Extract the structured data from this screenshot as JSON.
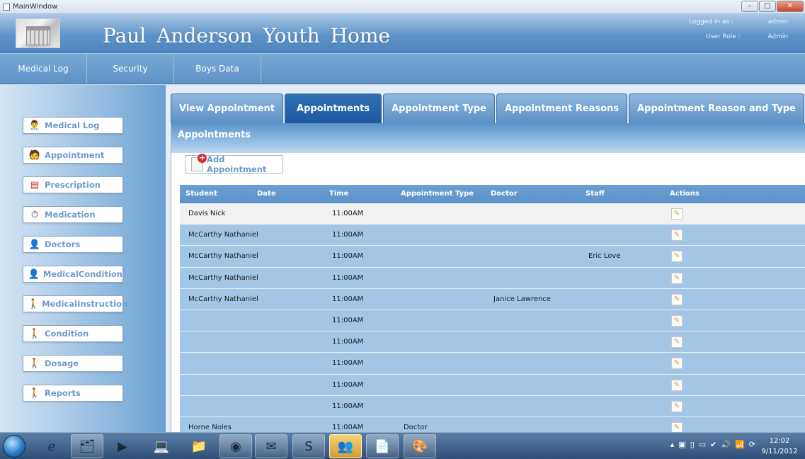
{
  "window": {
    "title": "MainWindow"
  },
  "header": {
    "app_title": "Paul  Anderson  Youth  Home",
    "logged_in_label": "Logged in as :",
    "logged_in_value": "admin",
    "role_label": "User Role :",
    "role_value": "Admin"
  },
  "topnav": {
    "items": [
      {
        "label": "Medical Log"
      },
      {
        "label": "Security"
      },
      {
        "label": "Boys Data"
      }
    ]
  },
  "sidebar": {
    "items": [
      {
        "label": "Medical Log",
        "icon": "medical-log-icon"
      },
      {
        "label": "Appointment",
        "icon": "appointment-icon"
      },
      {
        "label": "Prescription",
        "icon": "prescription-icon"
      },
      {
        "label": "Medication",
        "icon": "medication-icon"
      },
      {
        "label": "Doctors",
        "icon": "doctor-icon"
      },
      {
        "label": "MedicalCondition",
        "icon": "medical-condition-icon"
      },
      {
        "label": "MedicalInstruction",
        "icon": "medical-instruction-icon"
      },
      {
        "label": "Condition",
        "icon": "condition-icon"
      },
      {
        "label": "Dosage",
        "icon": "dosage-icon"
      },
      {
        "label": "Reports",
        "icon": "reports-icon"
      }
    ]
  },
  "tabs": [
    {
      "label": "View Appointment",
      "active": false
    },
    {
      "label": "Appointments",
      "active": true
    },
    {
      "label": "Appointment Type",
      "active": false
    },
    {
      "label": "Appointment Reasons",
      "active": false
    },
    {
      "label": "Appointment Reason and Type",
      "active": false
    }
  ],
  "panel": {
    "title": "Appointments",
    "add_button": "Add Appointment"
  },
  "table": {
    "columns": [
      "Student",
      "Date",
      "Time",
      "Appointment Type",
      "Doctor",
      "Staff",
      "Actions"
    ],
    "rows": [
      {
        "student": "Davis Nick",
        "date": "",
        "time": "11:00AM",
        "type": "",
        "doctor": "",
        "staff": ""
      },
      {
        "student": "McCarthy Nathaniel",
        "date": "",
        "time": "11:00AM",
        "type": "",
        "doctor": "",
        "staff": ""
      },
      {
        "student": "McCarthy Nathaniel",
        "date": "",
        "time": "11:00AM",
        "type": "",
        "doctor": "",
        "staff": "Eric Love"
      },
      {
        "student": "McCarthy Nathaniel",
        "date": "",
        "time": "11:00AM",
        "type": "",
        "doctor": "",
        "staff": ""
      },
      {
        "student": "McCarthy Nathaniel",
        "date": "",
        "time": "11:00AM",
        "type": "",
        "doctor": "Janice Lawrence",
        "staff": ""
      },
      {
        "student": "",
        "date": "",
        "time": "11:00AM",
        "type": "",
        "doctor": "",
        "staff": ""
      },
      {
        "student": "",
        "date": "",
        "time": "11:00AM",
        "type": "",
        "doctor": "",
        "staff": ""
      },
      {
        "student": "",
        "date": "",
        "time": "11:00AM",
        "type": "",
        "doctor": "",
        "staff": ""
      },
      {
        "student": "",
        "date": "",
        "time": "11:00AM",
        "type": "",
        "doctor": "",
        "staff": ""
      },
      {
        "student": "",
        "date": "",
        "time": "11:00AM",
        "type": "",
        "doctor": "",
        "staff": ""
      },
      {
        "student": "Horne Noles",
        "date": "",
        "time": "11:00AM",
        "type": "Doctor",
        "doctor": "",
        "staff": ""
      }
    ]
  },
  "taskbar": {
    "apps": [
      "internet-explorer-icon",
      "file-explorer-icon",
      "media-player-icon",
      "network-icon",
      "folder-icon",
      "chrome-icon",
      "outlook-icon",
      "skype-icon",
      "users-app-icon",
      "document-icon",
      "paint-icon"
    ],
    "time": "12:02",
    "date": "9/11/2012"
  }
}
